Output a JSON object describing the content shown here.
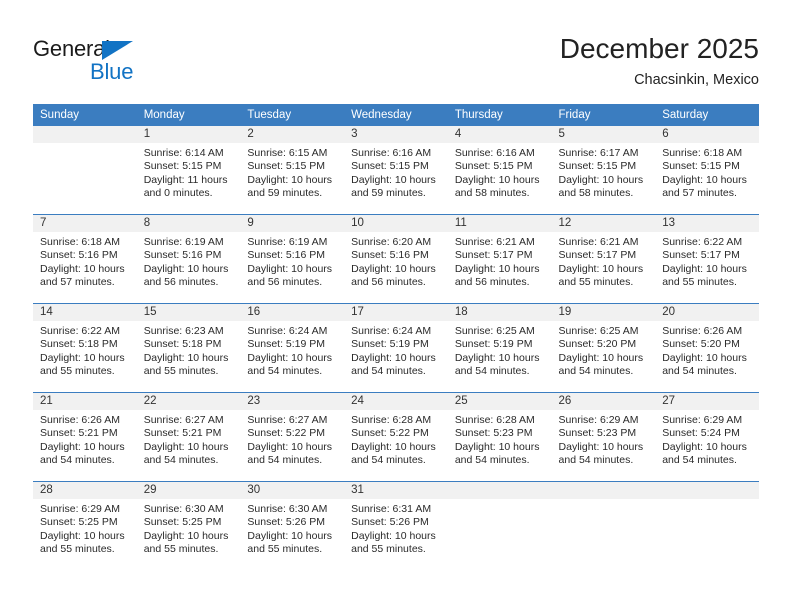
{
  "brand": {
    "name_part1": "General",
    "name_part2": "Blue",
    "accent_color": "#1273c4"
  },
  "header": {
    "title": "December 2025",
    "subtitle": "Chacsinkin, Mexico"
  },
  "calendar": {
    "header_color": "#3b7dc0",
    "weekday_headers": [
      "Sunday",
      "Monday",
      "Tuesday",
      "Wednesday",
      "Thursday",
      "Friday",
      "Saturday"
    ],
    "weeks": [
      [
        {
          "day": "",
          "sunrise": "",
          "sunset": "",
          "daylight_line1": "",
          "daylight_line2": ""
        },
        {
          "day": "1",
          "sunrise": "Sunrise: 6:14 AM",
          "sunset": "Sunset: 5:15 PM",
          "daylight_line1": "Daylight: 11 hours",
          "daylight_line2": "and 0 minutes."
        },
        {
          "day": "2",
          "sunrise": "Sunrise: 6:15 AM",
          "sunset": "Sunset: 5:15 PM",
          "daylight_line1": "Daylight: 10 hours",
          "daylight_line2": "and 59 minutes."
        },
        {
          "day": "3",
          "sunrise": "Sunrise: 6:16 AM",
          "sunset": "Sunset: 5:15 PM",
          "daylight_line1": "Daylight: 10 hours",
          "daylight_line2": "and 59 minutes."
        },
        {
          "day": "4",
          "sunrise": "Sunrise: 6:16 AM",
          "sunset": "Sunset: 5:15 PM",
          "daylight_line1": "Daylight: 10 hours",
          "daylight_line2": "and 58 minutes."
        },
        {
          "day": "5",
          "sunrise": "Sunrise: 6:17 AM",
          "sunset": "Sunset: 5:15 PM",
          "daylight_line1": "Daylight: 10 hours",
          "daylight_line2": "and 58 minutes."
        },
        {
          "day": "6",
          "sunrise": "Sunrise: 6:18 AM",
          "sunset": "Sunset: 5:15 PM",
          "daylight_line1": "Daylight: 10 hours",
          "daylight_line2": "and 57 minutes."
        }
      ],
      [
        {
          "day": "7",
          "sunrise": "Sunrise: 6:18 AM",
          "sunset": "Sunset: 5:16 PM",
          "daylight_line1": "Daylight: 10 hours",
          "daylight_line2": "and 57 minutes."
        },
        {
          "day": "8",
          "sunrise": "Sunrise: 6:19 AM",
          "sunset": "Sunset: 5:16 PM",
          "daylight_line1": "Daylight: 10 hours",
          "daylight_line2": "and 56 minutes."
        },
        {
          "day": "9",
          "sunrise": "Sunrise: 6:19 AM",
          "sunset": "Sunset: 5:16 PM",
          "daylight_line1": "Daylight: 10 hours",
          "daylight_line2": "and 56 minutes."
        },
        {
          "day": "10",
          "sunrise": "Sunrise: 6:20 AM",
          "sunset": "Sunset: 5:16 PM",
          "daylight_line1": "Daylight: 10 hours",
          "daylight_line2": "and 56 minutes."
        },
        {
          "day": "11",
          "sunrise": "Sunrise: 6:21 AM",
          "sunset": "Sunset: 5:17 PM",
          "daylight_line1": "Daylight: 10 hours",
          "daylight_line2": "and 56 minutes."
        },
        {
          "day": "12",
          "sunrise": "Sunrise: 6:21 AM",
          "sunset": "Sunset: 5:17 PM",
          "daylight_line1": "Daylight: 10 hours",
          "daylight_line2": "and 55 minutes."
        },
        {
          "day": "13",
          "sunrise": "Sunrise: 6:22 AM",
          "sunset": "Sunset: 5:17 PM",
          "daylight_line1": "Daylight: 10 hours",
          "daylight_line2": "and 55 minutes."
        }
      ],
      [
        {
          "day": "14",
          "sunrise": "Sunrise: 6:22 AM",
          "sunset": "Sunset: 5:18 PM",
          "daylight_line1": "Daylight: 10 hours",
          "daylight_line2": "and 55 minutes."
        },
        {
          "day": "15",
          "sunrise": "Sunrise: 6:23 AM",
          "sunset": "Sunset: 5:18 PM",
          "daylight_line1": "Daylight: 10 hours",
          "daylight_line2": "and 55 minutes."
        },
        {
          "day": "16",
          "sunrise": "Sunrise: 6:24 AM",
          "sunset": "Sunset: 5:19 PM",
          "daylight_line1": "Daylight: 10 hours",
          "daylight_line2": "and 54 minutes."
        },
        {
          "day": "17",
          "sunrise": "Sunrise: 6:24 AM",
          "sunset": "Sunset: 5:19 PM",
          "daylight_line1": "Daylight: 10 hours",
          "daylight_line2": "and 54 minutes."
        },
        {
          "day": "18",
          "sunrise": "Sunrise: 6:25 AM",
          "sunset": "Sunset: 5:19 PM",
          "daylight_line1": "Daylight: 10 hours",
          "daylight_line2": "and 54 minutes."
        },
        {
          "day": "19",
          "sunrise": "Sunrise: 6:25 AM",
          "sunset": "Sunset: 5:20 PM",
          "daylight_line1": "Daylight: 10 hours",
          "daylight_line2": "and 54 minutes."
        },
        {
          "day": "20",
          "sunrise": "Sunrise: 6:26 AM",
          "sunset": "Sunset: 5:20 PM",
          "daylight_line1": "Daylight: 10 hours",
          "daylight_line2": "and 54 minutes."
        }
      ],
      [
        {
          "day": "21",
          "sunrise": "Sunrise: 6:26 AM",
          "sunset": "Sunset: 5:21 PM",
          "daylight_line1": "Daylight: 10 hours",
          "daylight_line2": "and 54 minutes."
        },
        {
          "day": "22",
          "sunrise": "Sunrise: 6:27 AM",
          "sunset": "Sunset: 5:21 PM",
          "daylight_line1": "Daylight: 10 hours",
          "daylight_line2": "and 54 minutes."
        },
        {
          "day": "23",
          "sunrise": "Sunrise: 6:27 AM",
          "sunset": "Sunset: 5:22 PM",
          "daylight_line1": "Daylight: 10 hours",
          "daylight_line2": "and 54 minutes."
        },
        {
          "day": "24",
          "sunrise": "Sunrise: 6:28 AM",
          "sunset": "Sunset: 5:22 PM",
          "daylight_line1": "Daylight: 10 hours",
          "daylight_line2": "and 54 minutes."
        },
        {
          "day": "25",
          "sunrise": "Sunrise: 6:28 AM",
          "sunset": "Sunset: 5:23 PM",
          "daylight_line1": "Daylight: 10 hours",
          "daylight_line2": "and 54 minutes."
        },
        {
          "day": "26",
          "sunrise": "Sunrise: 6:29 AM",
          "sunset": "Sunset: 5:23 PM",
          "daylight_line1": "Daylight: 10 hours",
          "daylight_line2": "and 54 minutes."
        },
        {
          "day": "27",
          "sunrise": "Sunrise: 6:29 AM",
          "sunset": "Sunset: 5:24 PM",
          "daylight_line1": "Daylight: 10 hours",
          "daylight_line2": "and 54 minutes."
        }
      ],
      [
        {
          "day": "28",
          "sunrise": "Sunrise: 6:29 AM",
          "sunset": "Sunset: 5:25 PM",
          "daylight_line1": "Daylight: 10 hours",
          "daylight_line2": "and 55 minutes."
        },
        {
          "day": "29",
          "sunrise": "Sunrise: 6:30 AM",
          "sunset": "Sunset: 5:25 PM",
          "daylight_line1": "Daylight: 10 hours",
          "daylight_line2": "and 55 minutes."
        },
        {
          "day": "30",
          "sunrise": "Sunrise: 6:30 AM",
          "sunset": "Sunset: 5:26 PM",
          "daylight_line1": "Daylight: 10 hours",
          "daylight_line2": "and 55 minutes."
        },
        {
          "day": "31",
          "sunrise": "Sunrise: 6:31 AM",
          "sunset": "Sunset: 5:26 PM",
          "daylight_line1": "Daylight: 10 hours",
          "daylight_line2": "and 55 minutes."
        },
        {
          "day": "",
          "sunrise": "",
          "sunset": "",
          "daylight_line1": "",
          "daylight_line2": ""
        },
        {
          "day": "",
          "sunrise": "",
          "sunset": "",
          "daylight_line1": "",
          "daylight_line2": ""
        },
        {
          "day": "",
          "sunrise": "",
          "sunset": "",
          "daylight_line1": "",
          "daylight_line2": ""
        }
      ]
    ]
  }
}
